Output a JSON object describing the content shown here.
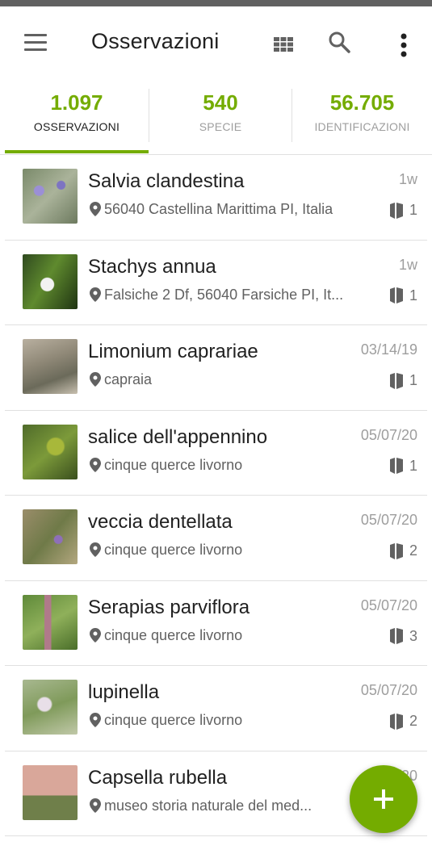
{
  "app_bar": {
    "title": "Osservazioni",
    "menu_icon": "menu-icon",
    "grid_icon": "grid-view-icon",
    "search_icon": "search-icon",
    "more_icon": "more-vert-icon"
  },
  "tabs": [
    {
      "count": "1.097",
      "label": "OSSERVAZIONI",
      "active": true
    },
    {
      "count": "540",
      "label": "SPECIE",
      "active": false
    },
    {
      "count": "56.705",
      "label": "IDENTIFICAZIONI",
      "active": false
    }
  ],
  "colors": {
    "accent": "#74ac00",
    "text": "#212121",
    "secondary": "#9e9e9e"
  },
  "observations": [
    {
      "name": "Salvia clandestina",
      "place": "56040 Castellina Marittima PI, Italia",
      "date": "1w",
      "ids": "1"
    },
    {
      "name": "Stachys annua",
      "place": "Falsiche 2 Df, 56040 Farsiche PI, It...",
      "date": "1w",
      "ids": "1"
    },
    {
      "name": "Limonium caprariae",
      "place": "capraia",
      "date": "03/14/19",
      "ids": "1"
    },
    {
      "name": "salice dell'appennino",
      "place": "cinque querce livorno",
      "date": "05/07/20",
      "ids": "1"
    },
    {
      "name": "veccia dentellata",
      "place": "cinque querce livorno",
      "date": "05/07/20",
      "ids": "2"
    },
    {
      "name": "Serapias parviflora",
      "place": "cinque querce livorno",
      "date": "05/07/20",
      "ids": "3"
    },
    {
      "name": "lupinella",
      "place": "cinque querce livorno",
      "date": "05/07/20",
      "ids": "2"
    },
    {
      "name": "Capsella rubella",
      "place": "museo storia naturale del med...",
      "date": "04/  /20",
      "ids": ""
    }
  ],
  "fab": {
    "icon": "plus-icon"
  }
}
